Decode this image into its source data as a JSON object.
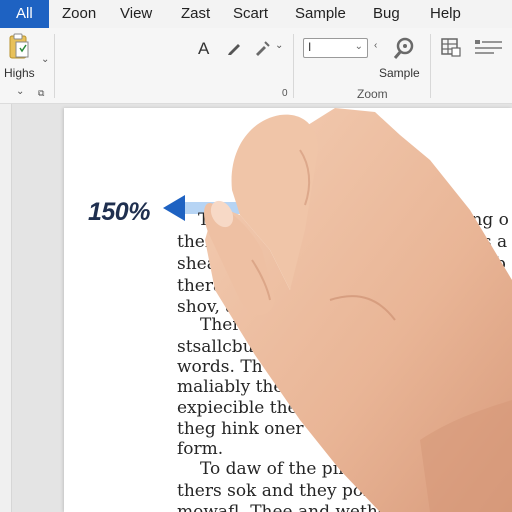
{
  "tabs": {
    "all": "All",
    "zoom": "Zoon",
    "view": "View",
    "zast": "Zast",
    "scart": "Scart",
    "sample": "Sample",
    "bug": "Bug",
    "help": "Help"
  },
  "ribbon": {
    "highs_label": "Highs",
    "group_left_number": "0",
    "zoom_group_label": "Zoom",
    "zoom_box_value": "I",
    "sample_label": "Sample",
    "font_glyph": "A",
    "accent_color": "#1e62c2"
  },
  "document": {
    "zoom_indicator": "150%",
    "lines": [
      "T",
      "ther",
      "shea",
      "thera",
      "shov, a",
      "Ther",
      "stsallcbul",
      "words. Th",
      "maliably the",
      "expiecible ther",
      "theg hink oner th",
      "form.",
      "To daw of the ping ta",
      "thers sok and they pofiiccu",
      "mowafl. Thee and wethe doc"
    ],
    "right_fragments": [
      "ing o",
      "gs a",
      "b"
    ]
  }
}
